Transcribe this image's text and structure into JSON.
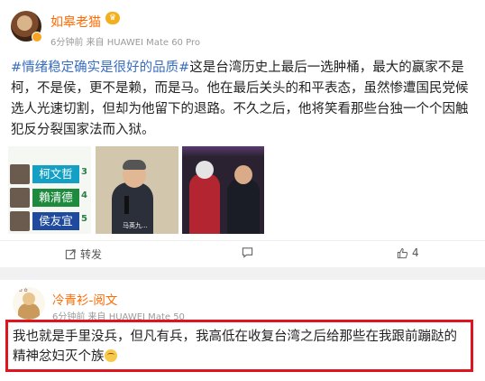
{
  "post1": {
    "username": "如皋老猫",
    "badge_icon": "crown-icon",
    "meta": "6分钟前 来自 HUAWEI Mate 60 Pro",
    "hashtag": "#情绪稳定确实是很好的品质#",
    "body": "这是台湾历史上最后一选肿桶，最大的赢家不是柯，不是侯，更不是赖，而是马。他在最后关头的和平表态，虽然惨遭国民党候选人光速切割，但却为他留下的退路。不久之后，他将笑看那些台独一个个因触犯反分裂国家法而入狱。",
    "images": {
      "candidates": [
        {
          "name": "柯文哲",
          "num": "3"
        },
        {
          "name": "賴清德",
          "num": "4"
        },
        {
          "name": "侯友宜",
          "num": "5"
        }
      ],
      "img2_caption": "马英九..."
    },
    "actions": {
      "share_label": "转发",
      "comment_label": "",
      "like_count": "4"
    }
  },
  "post2": {
    "username": "冷青衫-阅文",
    "meta": "6分钟前 来自 HUAWEI Mate 50",
    "body": "我也就是手里没兵，但凡有兵，我高低在收复台湾之后给那些在我跟前蹦跶的精神忿妇灭个族"
  },
  "colors": {
    "username": "#ff6a00",
    "hashtag": "#3a6ebf",
    "highlight_border": "#e0141e"
  }
}
